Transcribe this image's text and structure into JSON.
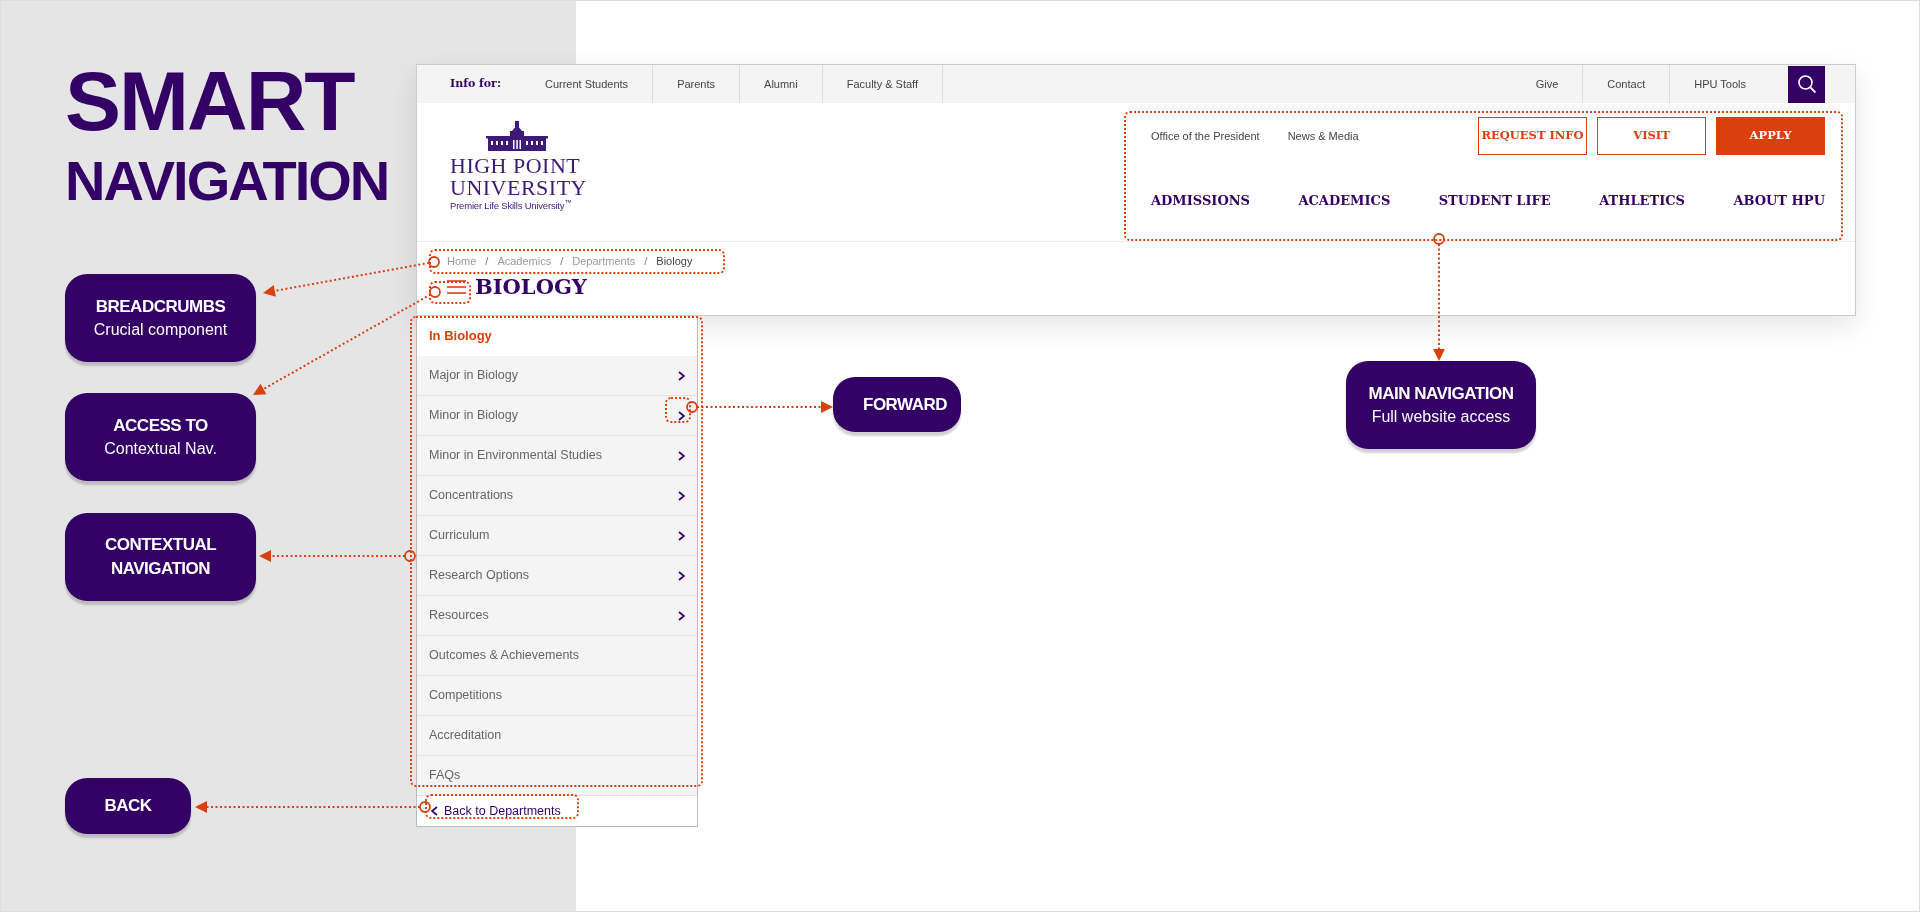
{
  "heading": {
    "line_1": "SMART",
    "line_2": "NAVIGATION"
  },
  "callouts": [
    {
      "title": "BREADCRUMBS",
      "subtitle": "Crucial component"
    },
    {
      "title": "ACCESS TO",
      "subtitle": "Contextual Nav."
    },
    {
      "title": "CONTEXTUAL NAVIGATION"
    },
    {
      "title": "BACK"
    },
    {
      "title": "FORWARD"
    },
    {
      "title": "MAIN NAVIGATION",
      "subtitle": "Full website access"
    }
  ],
  "website": {
    "utility_bar": {
      "label": "Info for:",
      "audience_links": [
        "Current Students",
        "Parents",
        "Alumni",
        "Faculty & Staff"
      ],
      "utility_links": [
        "Give",
        "Contact",
        "HPU Tools"
      ]
    },
    "logo": {
      "line_1": "HIGH POINT",
      "line_2": "UNIVERSITY",
      "tagline": "Premier Life Skills University$^{™}$"
    },
    "secondary_links": [
      "Office of the President",
      "News & Media"
    ],
    "action_buttons": [
      {
        "label": "REQUEST INFO",
        "kind": "outline"
      },
      {
        "label": "VISIT",
        "kind": "outline"
      },
      {
        "label": "APPLY",
        "kind": "filled"
      }
    ],
    "main_nav": [
      "ADMISSIONS",
      "ACADEMICS",
      "STUDENT LIFE",
      "ATHLETICS",
      "ABOUT HPU"
    ],
    "breadcrumbs": {
      "separator": "/",
      "items": [
        {
          "label": "Home",
          "current": false
        },
        {
          "label": "Academics",
          "current": false
        },
        {
          "label": "Departments",
          "current": false
        },
        {
          "label": "Biology",
          "current": true
        }
      ]
    },
    "page_title": "BIOLOGY",
    "section_menu": {
      "heading": "In Biology",
      "items": [
        {
          "label": "Major in Biology",
          "has_submenu": true
        },
        {
          "label": "Minor in Biology",
          "has_submenu": true
        },
        {
          "label": "Minor in Environmental Studies",
          "has_submenu": true
        },
        {
          "label": "Concentrations",
          "has_submenu": true
        },
        {
          "label": "Curriculum",
          "has_submenu": true
        },
        {
          "label": "Research Options",
          "has_submenu": true
        },
        {
          "label": "Resources",
          "has_submenu": true
        },
        {
          "label": "Outcomes & Achievements",
          "has_submenu": false
        },
        {
          "label": "Competitions",
          "has_submenu": false
        },
        {
          "label": "Accreditation",
          "has_submenu": false
        },
        {
          "label": "FAQs",
          "has_submenu": false
        }
      ],
      "back_link": "Back to Departments"
    }
  }
}
